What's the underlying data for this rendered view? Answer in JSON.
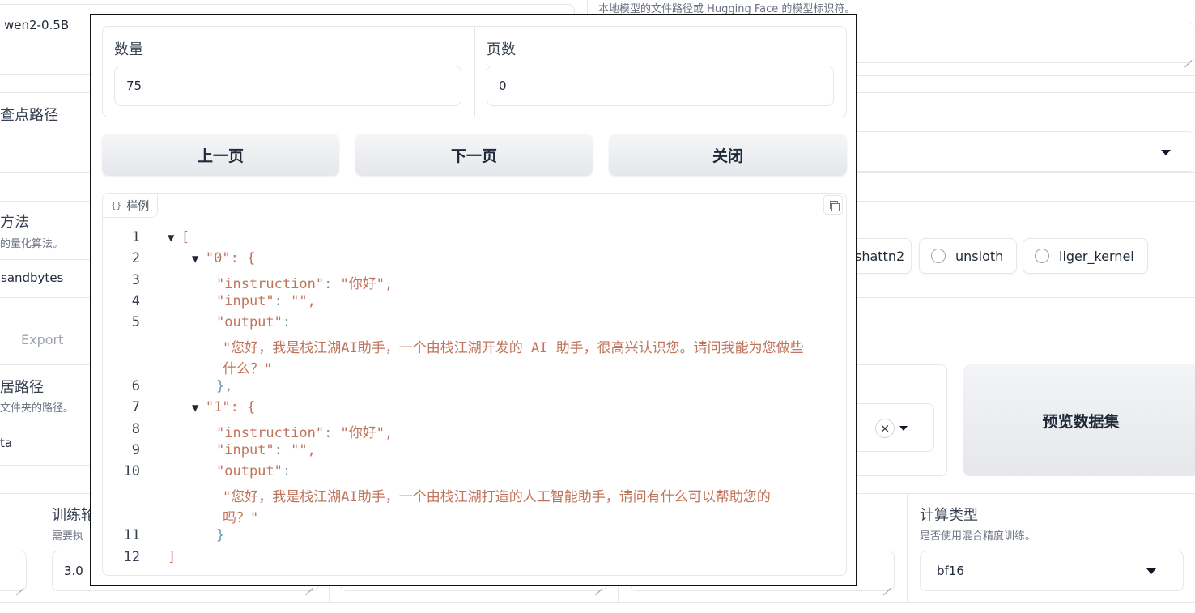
{
  "background": {
    "model_name_value": "wen2-0.5B",
    "model_path_hint": "本地模型的文件路径或 Hugging Face 的模型标识符。",
    "checkpoint_label": "查点路径",
    "quant_method_label": "方法",
    "quant_method_hint": "的量化算法。",
    "quant_value": "sandbytes",
    "booster_options": [
      "shattn2",
      "unsloth",
      "liger_kernel"
    ],
    "export_tab": "Export",
    "data_dir_label": "居路径",
    "data_dir_hint": "文件夹的路径。",
    "data_dir_value": "ta",
    "preview_button": "预览数据集",
    "epochs_label": "训练轮",
    "epochs_hint": "需要执",
    "epochs_value": "3.0",
    "compute_type_label": "计算类型",
    "compute_type_hint": "是否使用混合精度训练。",
    "compute_type_value": "bf16"
  },
  "modal": {
    "count_label": "数量",
    "count_value": "75",
    "page_label": "页数",
    "page_value": "0",
    "prev_button": "上一页",
    "next_button": "下一页",
    "close_button": "关闭",
    "code_tag": "样例",
    "code_lines": [
      {
        "n": "1",
        "text": "[",
        "kind": "bracket",
        "arrow": true,
        "indent": 0
      },
      {
        "n": "2",
        "text": "\"0\": {",
        "kind": "key",
        "arrow": true,
        "indent": 1
      },
      {
        "n": "3",
        "key": "\"instruction\"",
        "value": "\"你好\",",
        "indent": 2
      },
      {
        "n": "4",
        "key": "\"input\"",
        "value": "\"\",",
        "indent": 2
      },
      {
        "n": "5",
        "key": "\"output\"",
        "value": "",
        "indent": 2
      },
      {
        "n": "",
        "text": "\"您好，我是栈江湖AI助手，一个由栈江湖开发的 AI 助手，很高兴认识您。请问我能为您做些",
        "kind": "string",
        "indent": 3
      },
      {
        "n": "",
        "text": "什么？\"",
        "kind": "string",
        "indent": 3
      },
      {
        "n": "6",
        "text": "},",
        "kind": "punct",
        "indent": 2
      },
      {
        "n": "7",
        "text": "\"1\": {",
        "kind": "key",
        "arrow": true,
        "indent": 1
      },
      {
        "n": "8",
        "key": "\"instruction\"",
        "value": "\"你好\",",
        "indent": 2
      },
      {
        "n": "9",
        "key": "\"input\"",
        "value": "\"\",",
        "indent": 2
      },
      {
        "n": "10",
        "key": "\"output\"",
        "value": "",
        "indent": 2
      },
      {
        "n": "",
        "text": "\"您好，我是栈江湖AI助手，一个由栈江湖打造的人工智能助手，请问有什么可以帮助您的",
        "kind": "string",
        "indent": 3
      },
      {
        "n": "",
        "text": "吗？\"",
        "kind": "string",
        "indent": 3
      },
      {
        "n": "11",
        "text": "}",
        "kind": "punct",
        "indent": 2
      },
      {
        "n": "12",
        "text": "]",
        "kind": "bracket",
        "indent": 0
      }
    ]
  }
}
